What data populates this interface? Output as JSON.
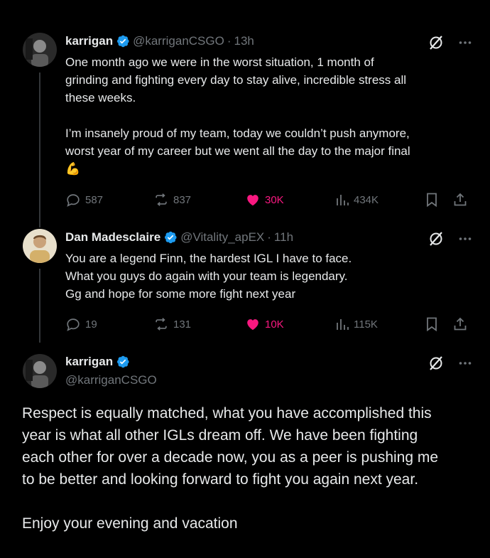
{
  "tweets": [
    {
      "name": "karrigan",
      "handle": "@karriganCSGO",
      "time": "13h",
      "text": "One month ago we were in the worst situation, 1 month of\ngrinding and fighting every day to stay alive, incredible stress all\nthese weeks.\n\nI’m insanely proud of my team, today we couldn’t push anymore,\nworst year of my career but we went all the day to the major final\n💪",
      "replies": "587",
      "reposts": "837",
      "likes": "30K",
      "views": "434K",
      "liked": true
    },
    {
      "name": "Dan Madesclaire",
      "handle": "@Vitality_apEX",
      "time": "11h",
      "text": "You are a legend Finn, the hardest IGL I have to face.\nWhat you guys do again with your team is legendary.\nGg and hope for some more fight next year",
      "replies": "19",
      "reposts": "131",
      "likes": "10K",
      "views": "115K",
      "liked": true
    }
  ],
  "main": {
    "name": "karrigan",
    "handle": "@karriganCSGO",
    "text": "Respect is equally matched, what you have accomplished this\nyear is what all other IGLs dream off. We have been fighting\neach other for over a decade now, you as a peer is pushing me\nto be better and looking forward to fight you again next year.\n\nEnjoy your evening and vacation"
  },
  "colors": {
    "background": "#000000",
    "text": "#e7e9ea",
    "muted": "#71767b",
    "verified": "#1d9bf0",
    "like": "#f91880"
  },
  "icons": [
    "verified-badge-icon",
    "grok-icon",
    "more-icon",
    "reply-icon",
    "repost-icon",
    "like-icon",
    "views-icon",
    "bookmark-icon",
    "share-icon"
  ]
}
